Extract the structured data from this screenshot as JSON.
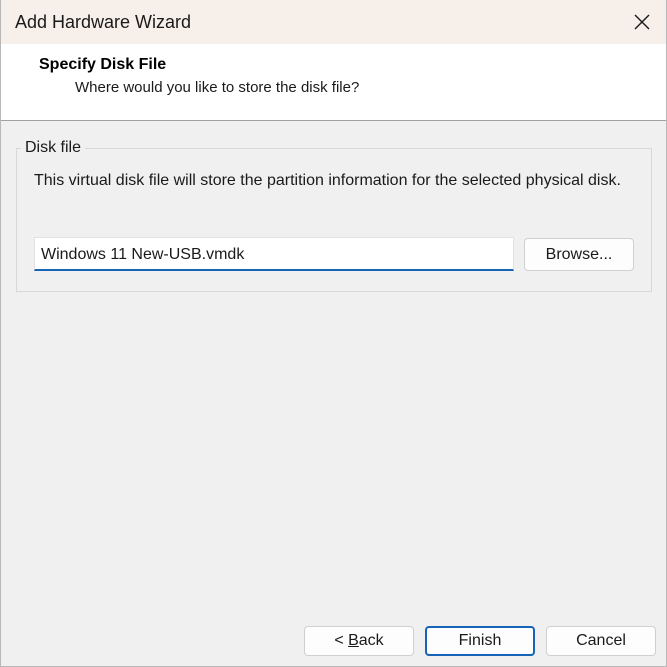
{
  "window": {
    "title": "Add Hardware Wizard"
  },
  "header": {
    "title": "Specify Disk File",
    "subtitle": "Where would you like to store the disk file?"
  },
  "disk_file_group": {
    "label": "Disk file",
    "description": "This virtual disk file will store the partition information for the selected physical disk.",
    "file_value": "Windows 11 New-USB.vmdk",
    "browse_label": "Browse..."
  },
  "footer": {
    "back_prefix": "< ",
    "back_mnemonic": "B",
    "back_rest": "ack",
    "finish_label": "Finish",
    "cancel_label": "Cancel"
  },
  "icons": {
    "close": "close-icon"
  },
  "colors": {
    "titlebar_bg": "#f7efe9",
    "accent": "#1763b8"
  }
}
